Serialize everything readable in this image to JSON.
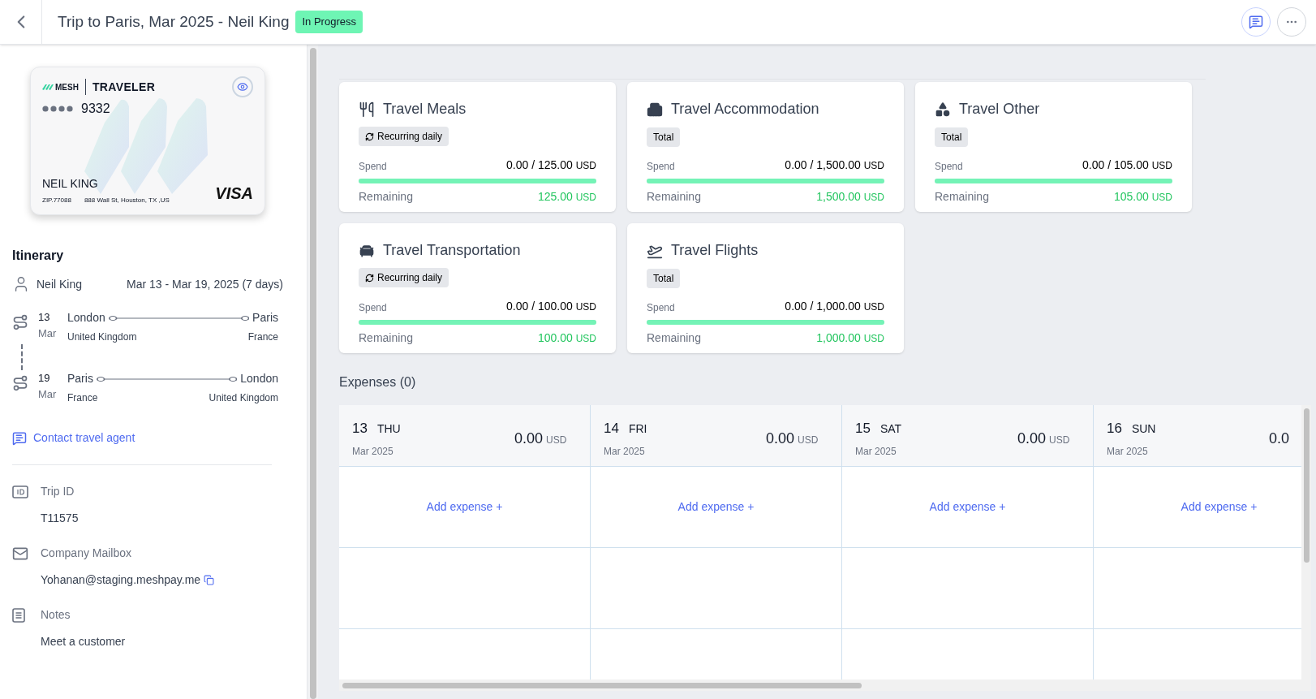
{
  "header": {
    "title": "Trip to Paris, Mar 2025 - Neil King",
    "status": "In Progress"
  },
  "traveler_card": {
    "brand": "MESH",
    "label": "TRAVELER",
    "last4": "9332",
    "name": "NEIL KING",
    "zip": "ZIP.77088",
    "address": "888 Wall St, Houston, TX ,US",
    "network": "VISA"
  },
  "itinerary": {
    "title": "Itinerary",
    "traveler": "Neil King",
    "dates": "Mar 13 - Mar 19, 2025 (7 days)",
    "legs": [
      {
        "day": "13",
        "month": "Mar",
        "from_city": "London",
        "from_country": "United Kingdom",
        "to_city": "Paris",
        "to_country": "France"
      },
      {
        "day": "19",
        "month": "Mar",
        "from_city": "Paris",
        "from_country": "France",
        "to_city": "London",
        "to_country": "United Kingdom"
      }
    ],
    "contact_link": "Contact travel agent"
  },
  "details": [
    {
      "kind": "id",
      "label": "Trip ID",
      "value": "T11575"
    },
    {
      "kind": "mail",
      "label": "Company Mailbox",
      "value": "Yohanan@staging.meshpay.me"
    },
    {
      "kind": "notes",
      "label": "Notes",
      "value": "Meet a customer"
    }
  ],
  "budgets": [
    {
      "kind": "meals",
      "title": "Travel Meals",
      "badge": "Recurring daily",
      "recurring": true,
      "spend_label": "Spend",
      "spend": "0.00 / 125.00",
      "currency": "USD",
      "level": 1,
      "remaining_label": "Remaining",
      "remaining": "125.00",
      "remaining_currency": "USD"
    },
    {
      "kind": "accommodation",
      "title": "Travel Accommodation",
      "badge": "Total",
      "recurring": false,
      "spend_label": "Spend",
      "spend": "0.00 / 1,500.00",
      "currency": "USD",
      "level": 1,
      "remaining_label": "Remaining",
      "remaining": "1,500.00",
      "remaining_currency": "USD"
    },
    {
      "kind": "other",
      "title": "Travel Other",
      "badge": "Total",
      "recurring": false,
      "spend_label": "Spend",
      "spend": "0.00 / 105.00",
      "currency": "USD",
      "level": 1,
      "remaining_label": "Remaining",
      "remaining": "105.00",
      "remaining_currency": "USD"
    },
    {
      "kind": "transportation",
      "title": "Travel Transportation",
      "badge": "Recurring daily",
      "recurring": true,
      "spend_label": "Spend",
      "spend": "0.00 / 100.00",
      "currency": "USD",
      "level": 1,
      "remaining_label": "Remaining",
      "remaining": "100.00",
      "remaining_currency": "USD"
    },
    {
      "kind": "flights",
      "title": "Travel Flights",
      "badge": "Total",
      "recurring": false,
      "spend_label": "Spend",
      "spend": "0.00 / 1,000.00",
      "currency": "USD",
      "level": 1,
      "remaining_label": "Remaining",
      "remaining": "1,000.00",
      "remaining_currency": "USD"
    }
  ],
  "expenses": {
    "title": "Expenses (0)",
    "days": [
      {
        "day": "13",
        "weekday": "THU",
        "month": "Mar 2025",
        "amount": "0.00",
        "currency": "USD",
        "add": "Add expense +"
      },
      {
        "day": "14",
        "weekday": "FRI",
        "month": "Mar 2025",
        "amount": "0.00",
        "currency": "USD",
        "add": "Add expense +"
      },
      {
        "day": "15",
        "weekday": "SAT",
        "month": "Mar 2025",
        "amount": "0.00",
        "currency": "USD",
        "add": "Add expense +"
      },
      {
        "day": "16",
        "weekday": "SUN",
        "month": "Mar 2025",
        "amount": "0.0",
        "add": "Add expense +"
      }
    ]
  }
}
